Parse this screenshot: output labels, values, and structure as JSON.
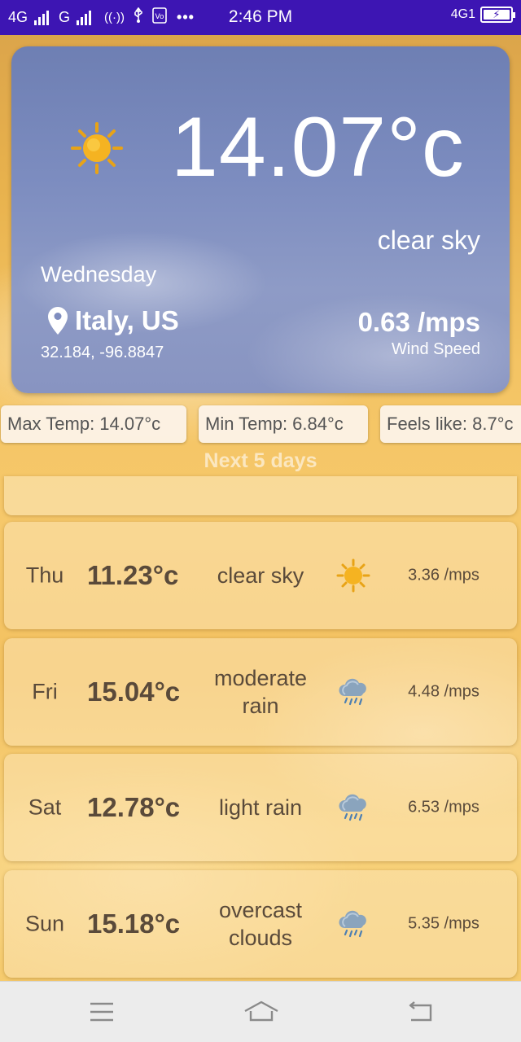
{
  "status_bar": {
    "net1": "4G",
    "net2": "G",
    "time": "2:46 PM",
    "right_net": "4G1",
    "icons": [
      "signal-icon",
      "signal-icon",
      "hotspot-icon",
      "usb-icon",
      "volte-icon",
      "more-dots-icon",
      "battery-charging-icon"
    ]
  },
  "current": {
    "temperature": "14.07°c",
    "condition": "clear sky",
    "day": "Wednesday",
    "location": "Italy, US",
    "coordinates": "32.184, -96.8847",
    "wind_speed": "0.63 /mps",
    "wind_label": "Wind Speed",
    "icon": "sun-icon"
  },
  "chips": {
    "max_temp": "Max Temp: 14.07°c",
    "min_temp": "Min Temp: 6.84°c",
    "feels_like": "Feels like: 8.7°c"
  },
  "forecast_header": "Next 5 days",
  "forecast": [
    {
      "day": "Thu",
      "temp": "11.23°c",
      "desc": "clear sky",
      "icon": "sun-icon",
      "wind": "3.36  /mps"
    },
    {
      "day": "Fri",
      "temp": "15.04°c",
      "desc": "moderate rain",
      "icon": "rain-cloud-icon",
      "wind": "4.48  /mps"
    },
    {
      "day": "Sat",
      "temp": "12.78°c",
      "desc": "light rain",
      "icon": "rain-cloud-icon",
      "wind": "6.53  /mps"
    },
    {
      "day": "Sun",
      "temp": "15.18°c",
      "desc": "overcast clouds",
      "icon": "rain-cloud-icon",
      "wind": "5.35  /mps"
    }
  ],
  "nav": {
    "menu": "menu-icon",
    "home": "home-icon",
    "back": "back-icon"
  }
}
